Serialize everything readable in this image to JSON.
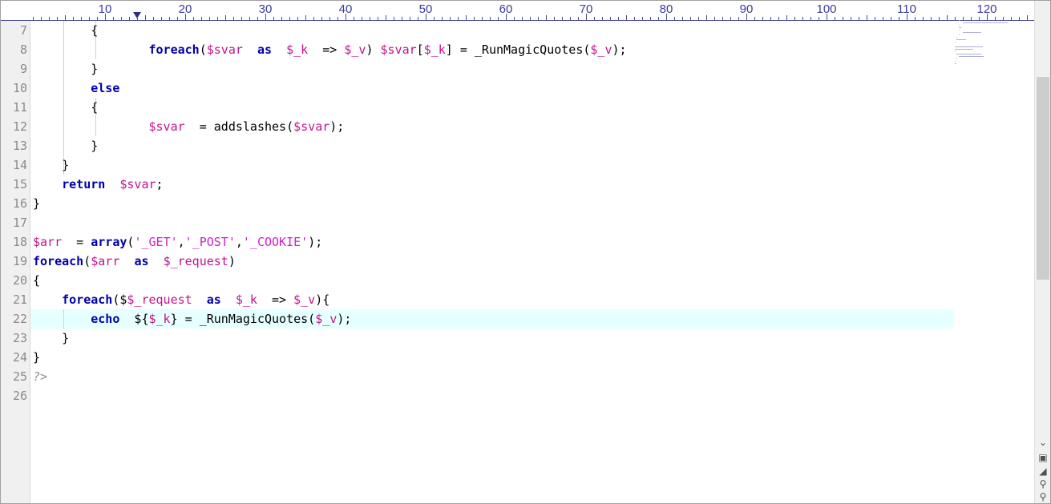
{
  "ruler": {
    "labels": [
      "10",
      "20",
      "30",
      "40",
      "50",
      "60",
      "70",
      "80",
      "90",
      "100",
      "110",
      "120"
    ]
  },
  "gutter": {
    "line_numbers": [
      "7",
      "8",
      "9",
      "10",
      "11",
      "12",
      "13",
      "14",
      "15",
      "16",
      "17",
      "18",
      "19",
      "20",
      "21",
      "22",
      "23",
      "24",
      "25",
      "26"
    ]
  },
  "editor": {
    "current_line": "22",
    "lines": [
      [
        {
          "t": "    {",
          "c": ""
        }
      ],
      [
        {
          "t": "        ",
          "c": ""
        },
        {
          "t": "foreach",
          "c": "kw"
        },
        {
          "t": "(",
          "c": ""
        },
        {
          "t": "$svar",
          "c": "var"
        },
        {
          "t": " ",
          "c": ""
        },
        {
          "t": "as",
          "c": "kw"
        },
        {
          "t": " ",
          "c": ""
        },
        {
          "t": "$_k",
          "c": "var"
        },
        {
          "t": " => ",
          "c": ""
        },
        {
          "t": "$_v",
          "c": "var"
        },
        {
          "t": ") ",
          "c": ""
        },
        {
          "t": "$svar",
          "c": "var"
        },
        {
          "t": "[",
          "c": ""
        },
        {
          "t": "$_k",
          "c": "var"
        },
        {
          "t": "] = _RunMagicQuotes(",
          "c": ""
        },
        {
          "t": "$_v",
          "c": "var"
        },
        {
          "t": ");",
          "c": ""
        }
      ],
      [
        {
          "t": "    }",
          "c": ""
        }
      ],
      [
        {
          "t": "    ",
          "c": ""
        },
        {
          "t": "else",
          "c": "kw"
        }
      ],
      [
        {
          "t": "    {",
          "c": ""
        }
      ],
      [
        {
          "t": "        ",
          "c": ""
        },
        {
          "t": "$svar",
          "c": "var"
        },
        {
          "t": " = addslashes(",
          "c": ""
        },
        {
          "t": "$svar",
          "c": "var"
        },
        {
          "t": ");",
          "c": ""
        }
      ],
      [
        {
          "t": "    }",
          "c": ""
        }
      ],
      [
        {
          "t": "  }",
          "c": ""
        }
      ],
      [
        {
          "t": "  ",
          "c": ""
        },
        {
          "t": "return",
          "c": "kw"
        },
        {
          "t": " ",
          "c": ""
        },
        {
          "t": "$svar",
          "c": "var"
        },
        {
          "t": ";",
          "c": ""
        }
      ],
      [
        {
          "t": "}",
          "c": ""
        }
      ],
      [],
      [
        {
          "t": "$arr",
          "c": "var"
        },
        {
          "t": " = ",
          "c": ""
        },
        {
          "t": "array",
          "c": "kw"
        },
        {
          "t": "(",
          "c": ""
        },
        {
          "t": "'_GET'",
          "c": "str"
        },
        {
          "t": ",",
          "c": ""
        },
        {
          "t": "'_POST'",
          "c": "str"
        },
        {
          "t": ",",
          "c": ""
        },
        {
          "t": "'_COOKIE'",
          "c": "str"
        },
        {
          "t": ");",
          "c": ""
        }
      ],
      [
        {
          "t": "foreach",
          "c": "kw"
        },
        {
          "t": "(",
          "c": ""
        },
        {
          "t": "$arr",
          "c": "var"
        },
        {
          "t": " ",
          "c": ""
        },
        {
          "t": "as",
          "c": "kw"
        },
        {
          "t": " ",
          "c": ""
        },
        {
          "t": "$_request",
          "c": "var"
        },
        {
          "t": ")",
          "c": ""
        }
      ],
      [
        {
          "t": "{",
          "c": ""
        }
      ],
      [
        {
          "t": "  ",
          "c": ""
        },
        {
          "t": "foreach",
          "c": "kw"
        },
        {
          "t": "($",
          "c": ""
        },
        {
          "t": "$_request",
          "c": "var"
        },
        {
          "t": " ",
          "c": ""
        },
        {
          "t": "as",
          "c": "kw"
        },
        {
          "t": " ",
          "c": ""
        },
        {
          "t": "$_k",
          "c": "var"
        },
        {
          "t": " => ",
          "c": ""
        },
        {
          "t": "$_v",
          "c": "var"
        },
        {
          "t": "){",
          "c": ""
        }
      ],
      [
        {
          "t": "    ",
          "c": ""
        },
        {
          "t": "echo",
          "c": "kw"
        },
        {
          "t": " ${",
          "c": ""
        },
        {
          "t": "$_k",
          "c": "var"
        },
        {
          "t": "} = _RunMagicQuotes(",
          "c": ""
        },
        {
          "t": "$_v",
          "c": "var"
        },
        {
          "t": ");",
          "c": ""
        }
      ],
      [
        {
          "t": "  }",
          "c": ""
        }
      ],
      [
        {
          "t": "}",
          "c": ""
        }
      ],
      [
        {
          "t": "?>",
          "c": "php"
        }
      ],
      []
    ]
  },
  "scrollbar": {
    "up_icon": "chevron-up-icon",
    "down_icon": "chevron-down-icon",
    "buttons": [
      "split-view-icon",
      "resize-icon",
      "search-icon",
      "zoom-icon"
    ]
  },
  "colors": {
    "keyword": "#0000aa",
    "variable": "#c0148c",
    "string": "#d020d0",
    "current_line": "#e6ffff",
    "line_numbers": "#8a8a8a",
    "ruler": "#3a3aa0"
  }
}
